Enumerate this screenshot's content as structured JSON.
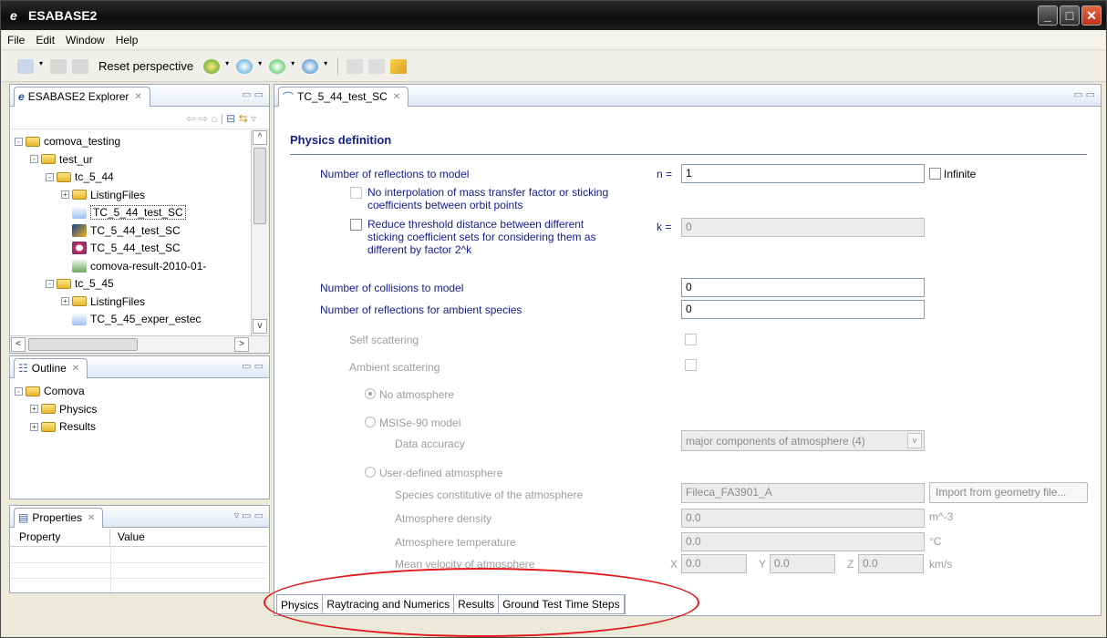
{
  "window": {
    "title": "ESABASE2"
  },
  "menu": {
    "items": [
      "File",
      "Edit",
      "Window",
      "Help"
    ]
  },
  "toolbar": {
    "reset_label": "Reset perspective"
  },
  "explorer": {
    "tab": "ESABASE2 Explorer",
    "tree": [
      {
        "label": "comova_testing",
        "depth": 0,
        "exp": "-",
        "type": "folder"
      },
      {
        "label": "test_ur",
        "depth": 1,
        "exp": "-",
        "type": "folder"
      },
      {
        "label": "tc_5_44",
        "depth": 2,
        "exp": "-",
        "type": "folder"
      },
      {
        "label": "ListingFiles",
        "depth": 3,
        "exp": "+",
        "type": "folder"
      },
      {
        "label": "TC_5_44_test_SC",
        "depth": 3,
        "exp": "",
        "type": "model",
        "selected": true
      },
      {
        "label": "TC_5_44_test_SC",
        "depth": 3,
        "exp": "",
        "type": "geom"
      },
      {
        "label": "TC_5_44_test_SC",
        "depth": 3,
        "exp": "",
        "type": "orbit"
      },
      {
        "label": "comova-result-2010-01-",
        "depth": 3,
        "exp": "",
        "type": "result"
      },
      {
        "label": "tc_5_45",
        "depth": 2,
        "exp": "-",
        "type": "folder"
      },
      {
        "label": "ListingFiles",
        "depth": 3,
        "exp": "+",
        "type": "folder"
      },
      {
        "label": "TC_5_45_exper_estec",
        "depth": 3,
        "exp": "",
        "type": "model"
      }
    ]
  },
  "outline": {
    "tab": "Outline",
    "tree": [
      {
        "label": "Comova",
        "depth": 0,
        "exp": "-"
      },
      {
        "label": "Physics",
        "depth": 1,
        "exp": "+"
      },
      {
        "label": "Results",
        "depth": 1,
        "exp": "+"
      }
    ]
  },
  "properties": {
    "tab": "Properties",
    "col_property": "Property",
    "col_value": "Value"
  },
  "editor": {
    "tab": "TC_5_44_test_SC",
    "section_title": "Physics definition",
    "reflections_label": "Number of reflections to model",
    "n_label": "n =",
    "n_value": "1",
    "infinite_label": "Infinite",
    "no_interp_label1": "No interpolation of mass transfer factor or sticking",
    "no_interp_label2": "coefficients between orbit points",
    "reduce_label1": "Reduce threshold distance between different",
    "reduce_label2": "sticking coefficient sets for considering them as",
    "reduce_label3": "different by factor 2^k",
    "k_label": "k =",
    "k_value": "0",
    "collisions_label": "Number of collisions to model",
    "collisions_value": "0",
    "ambient_reflections_label": "Number of reflections for ambient species",
    "ambient_reflections_value": "0",
    "self_scattering_label": "Self scattering",
    "ambient_scattering_label": "Ambient scattering",
    "no_atmosphere_label": "No atmosphere",
    "msise_label": "MSISe-90 model",
    "data_accuracy_label": "Data accuracy",
    "data_accuracy_value": "major components of atmosphere (4)",
    "user_atm_label": "User-defined atmosphere",
    "species_label": "Species constitutive of the atmosphere",
    "species_value": "Fileca_FA3901_A",
    "import_button": "Import from geometry file...",
    "density_label": "Atmosphere density",
    "density_value": "0.0",
    "density_unit": "m^-3",
    "temperature_label": "Atmosphere temperature",
    "temperature_value": "0.0",
    "temperature_unit": "°C",
    "velocity_label": "Mean velocity of atmosphere",
    "x_label": "X",
    "x_value": "0.0",
    "y_label": "Y",
    "y_value": "0.0",
    "z_label": "Z",
    "z_value": "0.0",
    "velocity_unit": "km/s"
  },
  "bottom_tabs": [
    "Physics",
    "Raytracing and Numerics",
    "Results",
    "Ground Test Time Steps"
  ]
}
